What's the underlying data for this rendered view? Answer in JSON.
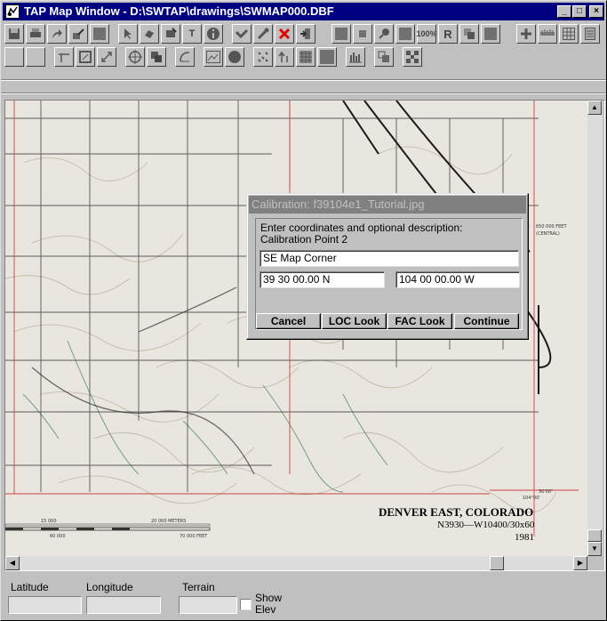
{
  "window": {
    "title": "TAP Map Window - D:\\SWTAP\\drawings\\SWMAP000.DBF",
    "controls": {
      "minimize": "_",
      "maximize": "□",
      "close": "×"
    }
  },
  "toolbar1": {
    "icons": [
      "save-icon",
      "print-icon",
      "forward-icon",
      "edit-icon",
      "fill-icon",
      "arrow-select-icon",
      "hand-icon",
      "stamp-icon",
      "text-icon",
      "info-icon",
      "route-icon",
      "pencil-icon",
      "delete-icon",
      "import-icon",
      "square-icon",
      "small-square-icon",
      "pin-icon",
      "square-icon",
      "percent-icon",
      "r-icon",
      "copy-icon",
      "box-icon",
      "plus-icon",
      "ruler-icon",
      "grid-icon",
      "notepad-icon"
    ],
    "labels": {
      "text": "T",
      "info": "i",
      "percent": "100%",
      "r": "R"
    }
  },
  "dialog": {
    "title": "Calibration: f39104e1_Tutorial.jpg",
    "instruction": "Enter coordinates and optional description:",
    "point": "Calibration Point 2",
    "description_value": "SE Map Corner",
    "latitude_value": "39 30 00.00 N",
    "longitude_value": "104 00 00.00 W",
    "buttons": {
      "cancel": "Cancel",
      "loc": "LOC Look",
      "fac": "FAC Look",
      "continue": "Continue"
    }
  },
  "map": {
    "title": "DENVER EAST, COLORADO",
    "code": "N3930—W10400/30x60",
    "year": "1981",
    "scale_labels": [
      "15 000",
      "20 000 METERS",
      "60 000",
      "70 000 FEET"
    ],
    "side_labels": [
      "650 000 FEET",
      "(CENTRAL)",
      "104°00'",
      "30'00\""
    ],
    "colors": {
      "paper": "#e8e6df",
      "contour": "#b9a994",
      "road": "#2b2b2b",
      "grid": "#d04040",
      "water": "#5a8a6a"
    }
  },
  "status": {
    "latitude_label": "Latitude",
    "longitude_label": "Longitude",
    "terrain_label": "Terrain",
    "show_label": "Show",
    "elev_label": "Elev"
  }
}
